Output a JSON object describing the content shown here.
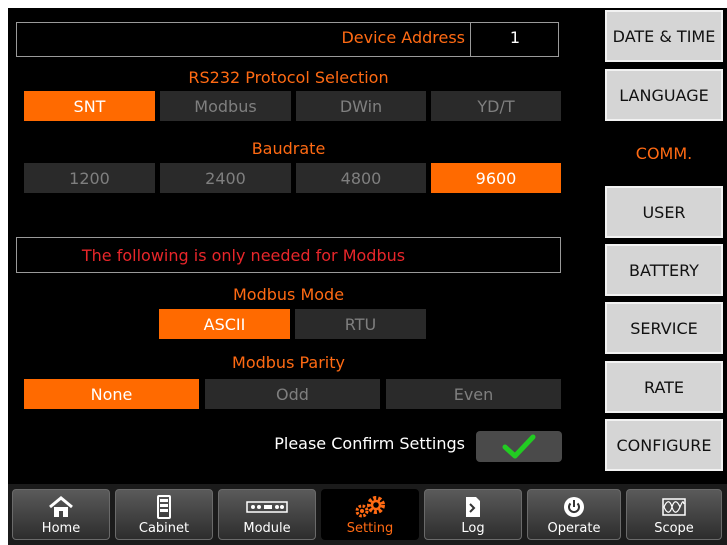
{
  "device": {
    "address_label": "Device Address",
    "address_value": "1"
  },
  "rs232": {
    "title": "RS232 Protocol Selection",
    "options": [
      "SNT",
      "Modbus",
      "DWin",
      "YD/T"
    ],
    "selected": "SNT"
  },
  "baudrate": {
    "title": "Baudrate",
    "options": [
      "1200",
      "2400",
      "4800",
      "9600"
    ],
    "selected": "9600"
  },
  "modbus_note": "The following is only needed for Modbus",
  "modbus_mode": {
    "title": "Modbus Mode",
    "options": [
      "ASCII",
      "RTU"
    ],
    "selected": "ASCII"
  },
  "modbus_parity": {
    "title": "Modbus Parity",
    "options": [
      "None",
      "Odd",
      "Even"
    ],
    "selected": "None"
  },
  "confirm": {
    "label": "Please Confirm Settings",
    "icon": "check-icon"
  },
  "side_menu": {
    "items": [
      "DATE & TIME",
      "LANGUAGE",
      "COMM.",
      "USER",
      "BATTERY",
      "SERVICE",
      "RATE",
      "CONFIGURE"
    ],
    "active": "COMM."
  },
  "bottom_nav": {
    "items": [
      {
        "label": "Home",
        "icon": "home-icon"
      },
      {
        "label": "Cabinet",
        "icon": "cabinet-icon"
      },
      {
        "label": "Module",
        "icon": "module-icon"
      },
      {
        "label": "Setting",
        "icon": "gear-icon"
      },
      {
        "label": "Log",
        "icon": "log-icon"
      },
      {
        "label": "Operate",
        "icon": "power-icon"
      },
      {
        "label": "Scope",
        "icon": "scope-icon"
      }
    ],
    "active": "Setting"
  },
  "colors": {
    "accent": "#ff6a00",
    "warning_text": "#e8262a",
    "confirm_check": "#22cc22",
    "inactive_option": "#2a2a2a"
  }
}
